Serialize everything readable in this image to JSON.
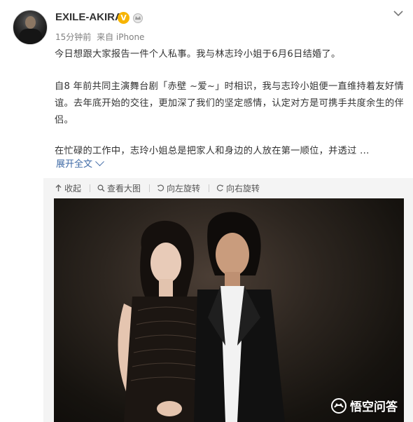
{
  "header": {
    "username": "EXILE-AKIRA",
    "time": "15分钟前",
    "source": "来自 iPhone"
  },
  "post": {
    "line1": "今日想跟大家报告一件个人私事。我与林志玲小姐于6月6日结婚了。",
    "para2": "自8 年前共同主演舞台剧「赤壁 ~爱~」时相识，我与志玲小姐便一直维持着友好情谊。去年底开始的交往，更加深了我们的坚定感情，认定对方是可携手共度余生的伴侣。",
    "para3": "在忙碌的工作中，志玲小姐总是把家人和身边的人放在第一顺位，并透过 ...",
    "expand_label": "展开全文"
  },
  "media_toolbar": {
    "collapse": "收起",
    "view_large": "查看大图",
    "rotate_left": "向左旋转",
    "rotate_right": "向右旋转"
  },
  "watermark": "悟空问答",
  "colors": {
    "link": "#3f6aa6",
    "verified": "#f7b400"
  }
}
